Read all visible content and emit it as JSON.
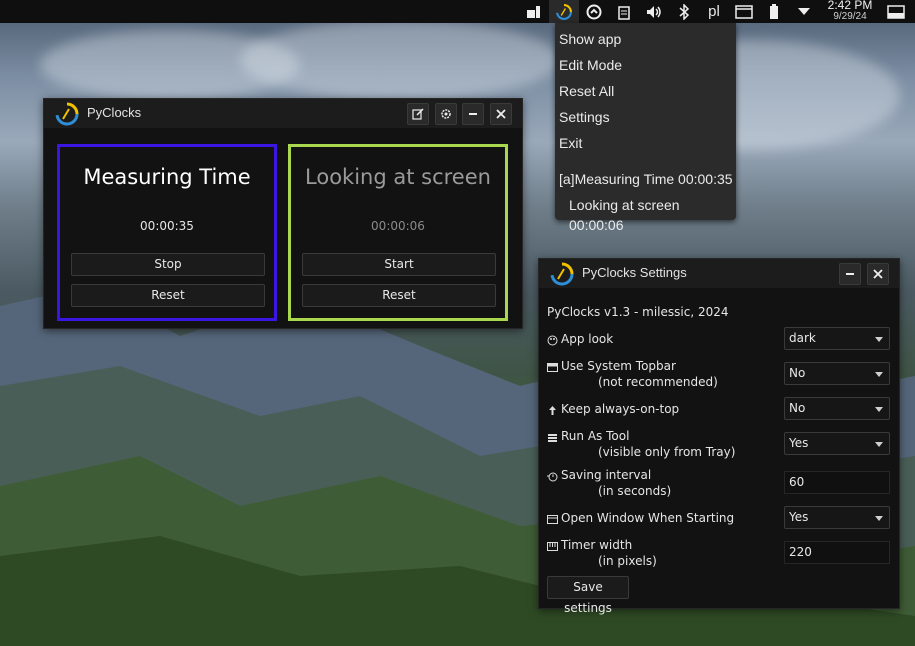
{
  "topbar": {
    "icons": [
      "app-icon",
      "pyclocks-icon",
      "sync-icon",
      "clipboard-icon",
      "volume-icon",
      "bluetooth-icon",
      "display-icon",
      "battery-icon",
      "chevron-down-icon",
      "window-icon"
    ],
    "keyboard_layout": "pl",
    "time": "2:42 PM",
    "date": "9/29/24"
  },
  "tray_menu": {
    "items": [
      "Show app",
      "Edit Mode",
      "Reset All",
      "Settings",
      "Exit"
    ],
    "timers": [
      "[a]Measuring Time 00:00:35",
      "Looking at screen 00:00:06"
    ]
  },
  "main_window": {
    "title": "PyClocks",
    "buttons": [
      "edit-icon",
      "settings-icon",
      "minimize-icon",
      "close-icon"
    ],
    "clocks": [
      {
        "name": "Measuring Time",
        "time": "00:00:35",
        "primary_label": "Stop",
        "reset_label": "Reset",
        "border_color": "#3a16e0",
        "text_color": "#ffffff",
        "time_color": "#e6e6e6"
      },
      {
        "name": "Looking at screen",
        "time": "00:00:06",
        "primary_label": "Start",
        "reset_label": "Reset",
        "border_color": "#a9d84e",
        "text_color": "#9a9a9a",
        "time_color": "#8a8a8a"
      }
    ]
  },
  "settings_window": {
    "title": "PyClocks Settings",
    "version": "PyClocks v1.3 - milessic, 2024",
    "rows": [
      {
        "icon": "palette-icon",
        "label": "App look",
        "sublabel": "",
        "value": "dark",
        "type": "combo"
      },
      {
        "icon": "topbar-icon",
        "label": "Use System Topbar",
        "sublabel": "(not recommended)",
        "value": "No",
        "type": "combo"
      },
      {
        "icon": "pin-icon",
        "label": "Keep always-on-top",
        "sublabel": "",
        "value": "No",
        "type": "combo"
      },
      {
        "icon": "tool-icon",
        "label": "Run As Tool",
        "sublabel": "(visible only from Tray)",
        "value": "Yes",
        "type": "combo"
      },
      {
        "icon": "timer-icon",
        "label": "Saving interval",
        "sublabel": "(in seconds)",
        "value": "60",
        "type": "input"
      },
      {
        "icon": "window-icon",
        "label": "Open Window When Starting",
        "sublabel": "",
        "value": "Yes",
        "type": "combo"
      },
      {
        "icon": "ruler-icon",
        "label": "Timer width",
        "sublabel": "(in pixels)",
        "value": "220",
        "type": "input"
      }
    ],
    "save_label": "Save settings"
  },
  "colors": {
    "accent_blue": "#3a16e0",
    "accent_green": "#a9d84e",
    "logo_yellow": "#f2c200",
    "logo_blue": "#2f8fd6"
  }
}
